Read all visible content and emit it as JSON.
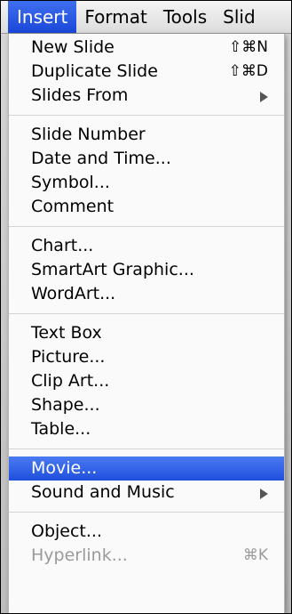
{
  "menubar": {
    "items": [
      "Insert",
      "Format",
      "Tools",
      "Slid"
    ]
  },
  "menu": {
    "new_slide": {
      "label": "New Slide",
      "shortcut": "⇧⌘N"
    },
    "duplicate_slide": {
      "label": "Duplicate Slide",
      "shortcut": "⇧⌘D"
    },
    "slides_from": {
      "label": "Slides From"
    },
    "slide_number": {
      "label": "Slide Number"
    },
    "date_and_time": {
      "label": "Date and Time..."
    },
    "symbol": {
      "label": "Symbol..."
    },
    "comment": {
      "label": "Comment"
    },
    "chart": {
      "label": "Chart..."
    },
    "smartart": {
      "label": "SmartArt Graphic..."
    },
    "wordart": {
      "label": "WordArt..."
    },
    "text_box": {
      "label": "Text Box"
    },
    "picture": {
      "label": "Picture..."
    },
    "clip_art": {
      "label": "Clip Art..."
    },
    "shape": {
      "label": "Shape..."
    },
    "table": {
      "label": "Table..."
    },
    "movie": {
      "label": "Movie..."
    },
    "sound_and_music": {
      "label": "Sound and Music"
    },
    "object": {
      "label": "Object..."
    },
    "hyperlink": {
      "label": "Hyperlink...",
      "shortcut": "⌘K"
    }
  }
}
